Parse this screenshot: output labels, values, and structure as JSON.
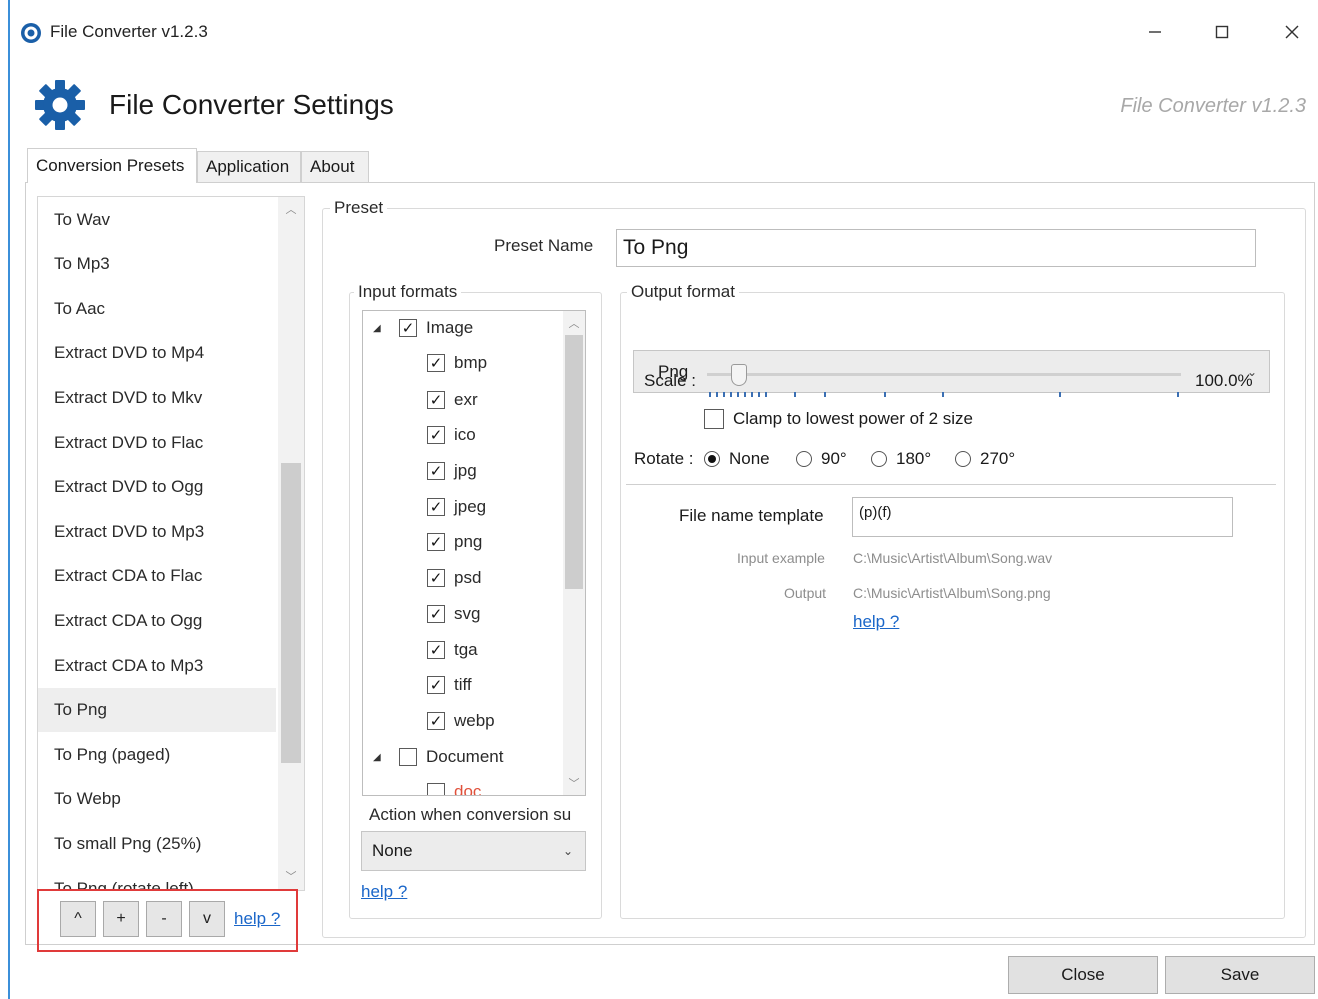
{
  "window": {
    "title": "File Converter v1.2.3",
    "controls": [
      "minimize-icon",
      "maximize-icon",
      "close-icon"
    ]
  },
  "header": {
    "title": "File Converter Settings",
    "version": "File Converter v1.2.3",
    "icon": "gear-icon",
    "accent_color": "#1a5fa8"
  },
  "tabs": [
    {
      "label": "Conversion Presets",
      "active": true
    },
    {
      "label": "Application",
      "active": false
    },
    {
      "label": "About",
      "active": false
    }
  ],
  "preset_list": {
    "items": [
      "To Wav",
      "To Mp3",
      "To Aac",
      "Extract DVD to Mp4",
      "Extract DVD to Mkv",
      "Extract DVD to Flac",
      "Extract DVD to Ogg",
      "Extract DVD to Mp3",
      "Extract CDA to Flac",
      "Extract CDA to Ogg",
      "Extract CDA to Mp3",
      "To Png",
      "To Png (paged)",
      "To Webp",
      "To small Png (25%)",
      "To Png (rotate left)"
    ],
    "selected_index": 11,
    "controls": {
      "move_up": "^",
      "add": "+",
      "remove": "-",
      "move_down": "v",
      "help": "help ?"
    }
  },
  "preset": {
    "group_label": "Preset",
    "name_label": "Preset Name",
    "name_value": "To Png",
    "input_formats": {
      "group_label": "Input formats",
      "tree": [
        {
          "label": "Image",
          "checked": true,
          "expanded": true,
          "level": 0
        },
        {
          "label": "bmp",
          "checked": true,
          "level": 1
        },
        {
          "label": "exr",
          "checked": true,
          "level": 1
        },
        {
          "label": "ico",
          "checked": true,
          "level": 1
        },
        {
          "label": "jpg",
          "checked": true,
          "level": 1
        },
        {
          "label": "jpeg",
          "checked": true,
          "level": 1
        },
        {
          "label": "png",
          "checked": true,
          "level": 1
        },
        {
          "label": "psd",
          "checked": true,
          "level": 1
        },
        {
          "label": "svg",
          "checked": true,
          "level": 1
        },
        {
          "label": "tga",
          "checked": true,
          "level": 1
        },
        {
          "label": "tiff",
          "checked": true,
          "level": 1
        },
        {
          "label": "webp",
          "checked": true,
          "level": 1
        },
        {
          "label": "Document",
          "checked": false,
          "expanded": true,
          "level": 0
        },
        {
          "label": "doc",
          "checked": false,
          "level": 1
        }
      ],
      "action_label": "Action when conversion su",
      "action_value": "None",
      "help": "help ?"
    },
    "output_format": {
      "group_label": "Output format",
      "format_value": "Png",
      "scale_label": "Scale :",
      "scale_value": "100.0%",
      "scale_fraction": 0.06,
      "clamp_label": "Clamp to lowest power of 2 size",
      "clamp_checked": false,
      "rotate_label": "Rotate :",
      "rotate_options": [
        "None",
        "90°",
        "180°",
        "270°"
      ],
      "rotate_selected": 0,
      "template_label": "File name template",
      "template_value": "(p)(f)",
      "input_example_label": "Input example",
      "input_example_value": "C:\\Music\\Artist\\Album\\Song.wav",
      "output_label": "Output",
      "output_value": "C:\\Music\\Artist\\Album\\Song.png",
      "help": "help ?"
    }
  },
  "footer": {
    "close_label": "Close",
    "save_label": "Save"
  },
  "colors": {
    "link": "#1a66c9",
    "highlight_border": "#e03a3a",
    "selected_row": "#eeeeee"
  }
}
